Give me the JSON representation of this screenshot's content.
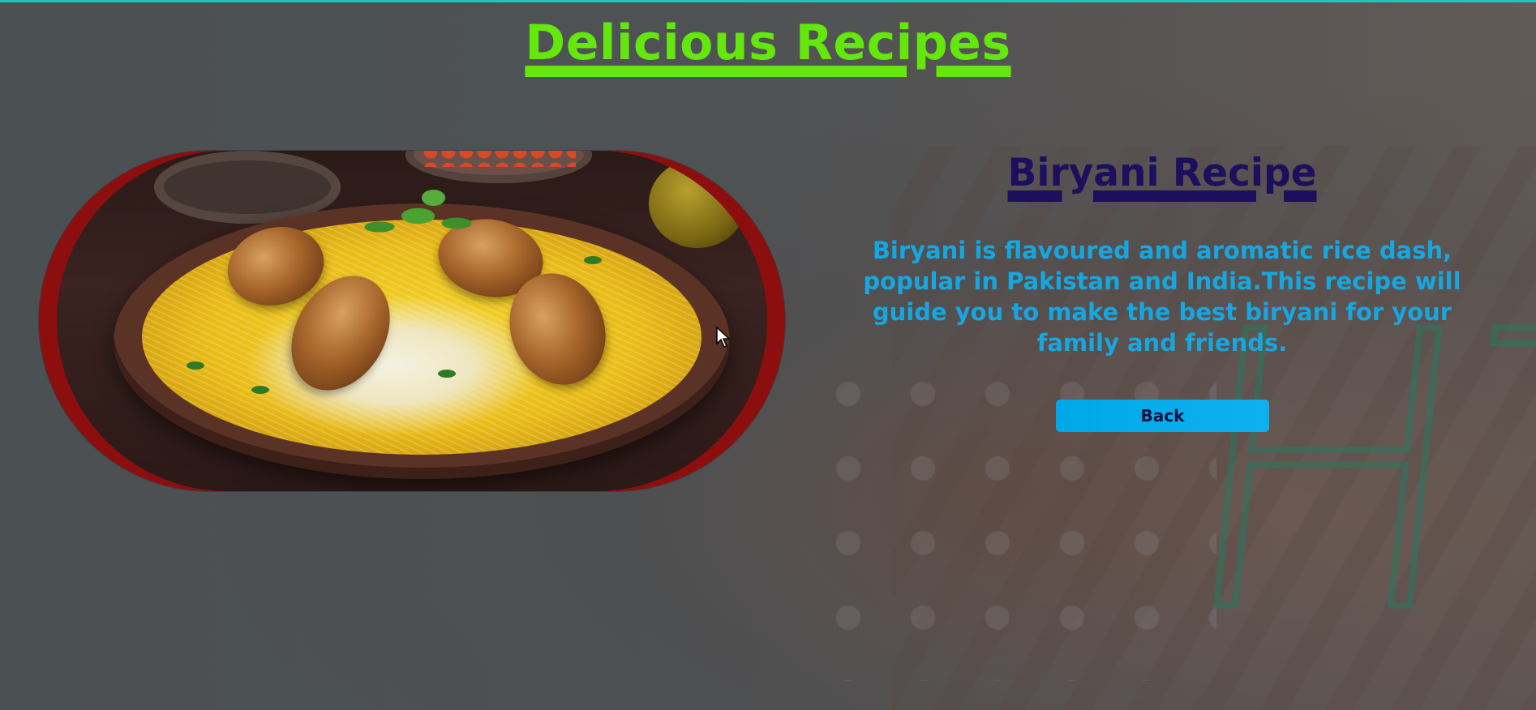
{
  "header": {
    "title": "Delicious Recipes"
  },
  "recipe": {
    "title": "Biryani Recipe",
    "description": "Biryani is flavoured and aromatic rice dash, popular in Pakistan and India.This recipe will guide you to make the best biryani for your family and friends.",
    "image_alt": "Biryani dish",
    "back_label": "Back"
  },
  "background": {
    "watermark_text": "HT"
  },
  "colors": {
    "title": "#64e70c",
    "recipe_title": "#1b0f5e",
    "description": "#16a6e0",
    "button": "#00a8e8",
    "image_frame": "#8c0e0e",
    "top_line": "#23c4b5"
  }
}
